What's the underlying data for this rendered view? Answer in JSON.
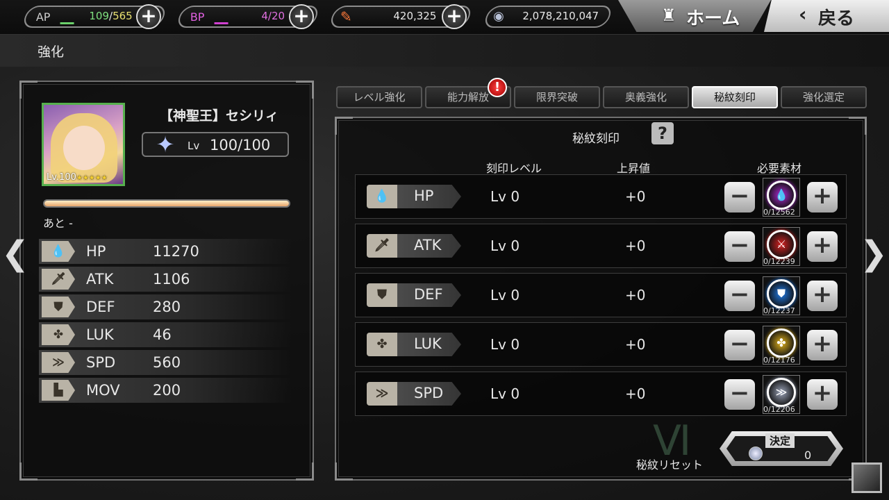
{
  "topbar": {
    "ap": {
      "label": "AP",
      "current": "109",
      "sep": "/",
      "max": "565",
      "value_text": "109/565"
    },
    "bp": {
      "label": "BP",
      "value_text": "4/20"
    },
    "crystals": {
      "value_text": "420,325"
    },
    "stones": {
      "value_text": "2,078,210,047"
    },
    "home_label": "ホーム",
    "back_label": "戻る",
    "home_icon": "castle-icon",
    "back_icon": "chevron-left-icon"
  },
  "page": {
    "title": "強化"
  },
  "character": {
    "name": "【神聖王】セシリィ",
    "portrait_level": "Lv.100",
    "portrait_stars": "★★★★★",
    "lv_label": "Lv",
    "lv_value": "100/100",
    "exp_fill": 1.0,
    "remain_text": "あと -",
    "stats": [
      {
        "icon": "drop-icon",
        "glyph": "💧",
        "name": "HP",
        "value": "11270"
      },
      {
        "icon": "sword-icon",
        "glyph": "🗡",
        "name": "ATK",
        "value": "1106"
      },
      {
        "icon": "shield-icon",
        "glyph": "⛊",
        "name": "DEF",
        "value": "280"
      },
      {
        "icon": "clover-icon",
        "glyph": "✤",
        "name": "LUK",
        "value": "46"
      },
      {
        "icon": "double-chevron-icon",
        "glyph": "≫",
        "name": "SPD",
        "value": "560"
      },
      {
        "icon": "boot-icon",
        "glyph": "▙",
        "name": "MOV",
        "value": "200"
      }
    ]
  },
  "tabs": [
    {
      "label": "レベル強化",
      "active": false
    },
    {
      "label": "能力解放",
      "active": false
    },
    {
      "label": "限界突破",
      "active": false
    },
    {
      "label": "奥義強化",
      "active": false
    },
    {
      "label": "秘紋刻印",
      "active": true
    },
    {
      "label": "強化選定",
      "active": false
    }
  ],
  "tab_alert": "!",
  "panel": {
    "title": "秘紋刻印",
    "help": "?",
    "col_level": "刻印レベル",
    "col_increase": "上昇値",
    "col_material": "必要素材",
    "rows": [
      {
        "icon": "drop-icon",
        "glyph": "💧",
        "name": "HP",
        "level": "Lv 0",
        "increase": "+0",
        "material": "0/12562",
        "mat_color": "#b02ad6",
        "mat_glyph": "💧"
      },
      {
        "icon": "sword-icon",
        "glyph": "🗡",
        "name": "ATK",
        "level": "Lv 0",
        "increase": "+0",
        "material": "0/12239",
        "mat_color": "#d62020",
        "mat_glyph": "⚔"
      },
      {
        "icon": "shield-icon",
        "glyph": "⛊",
        "name": "DEF",
        "level": "Lv 0",
        "increase": "+0",
        "material": "0/12237",
        "mat_color": "#1f7be8",
        "mat_glyph": "⛊"
      },
      {
        "icon": "clover-icon",
        "glyph": "✤",
        "name": "LUK",
        "level": "Lv 0",
        "increase": "+0",
        "material": "0/12176",
        "mat_color": "#e2b21a",
        "mat_glyph": "✤"
      },
      {
        "icon": "double-chevron-icon",
        "glyph": "≫",
        "name": "SPD",
        "level": "Lv 0",
        "increase": "+0",
        "material": "0/12206",
        "mat_color": "#9aa3b8",
        "mat_glyph": "≫"
      }
    ]
  },
  "footer": {
    "reset_label": "秘紋リセット",
    "confirm_label": "決定",
    "confirm_cost": "0"
  }
}
